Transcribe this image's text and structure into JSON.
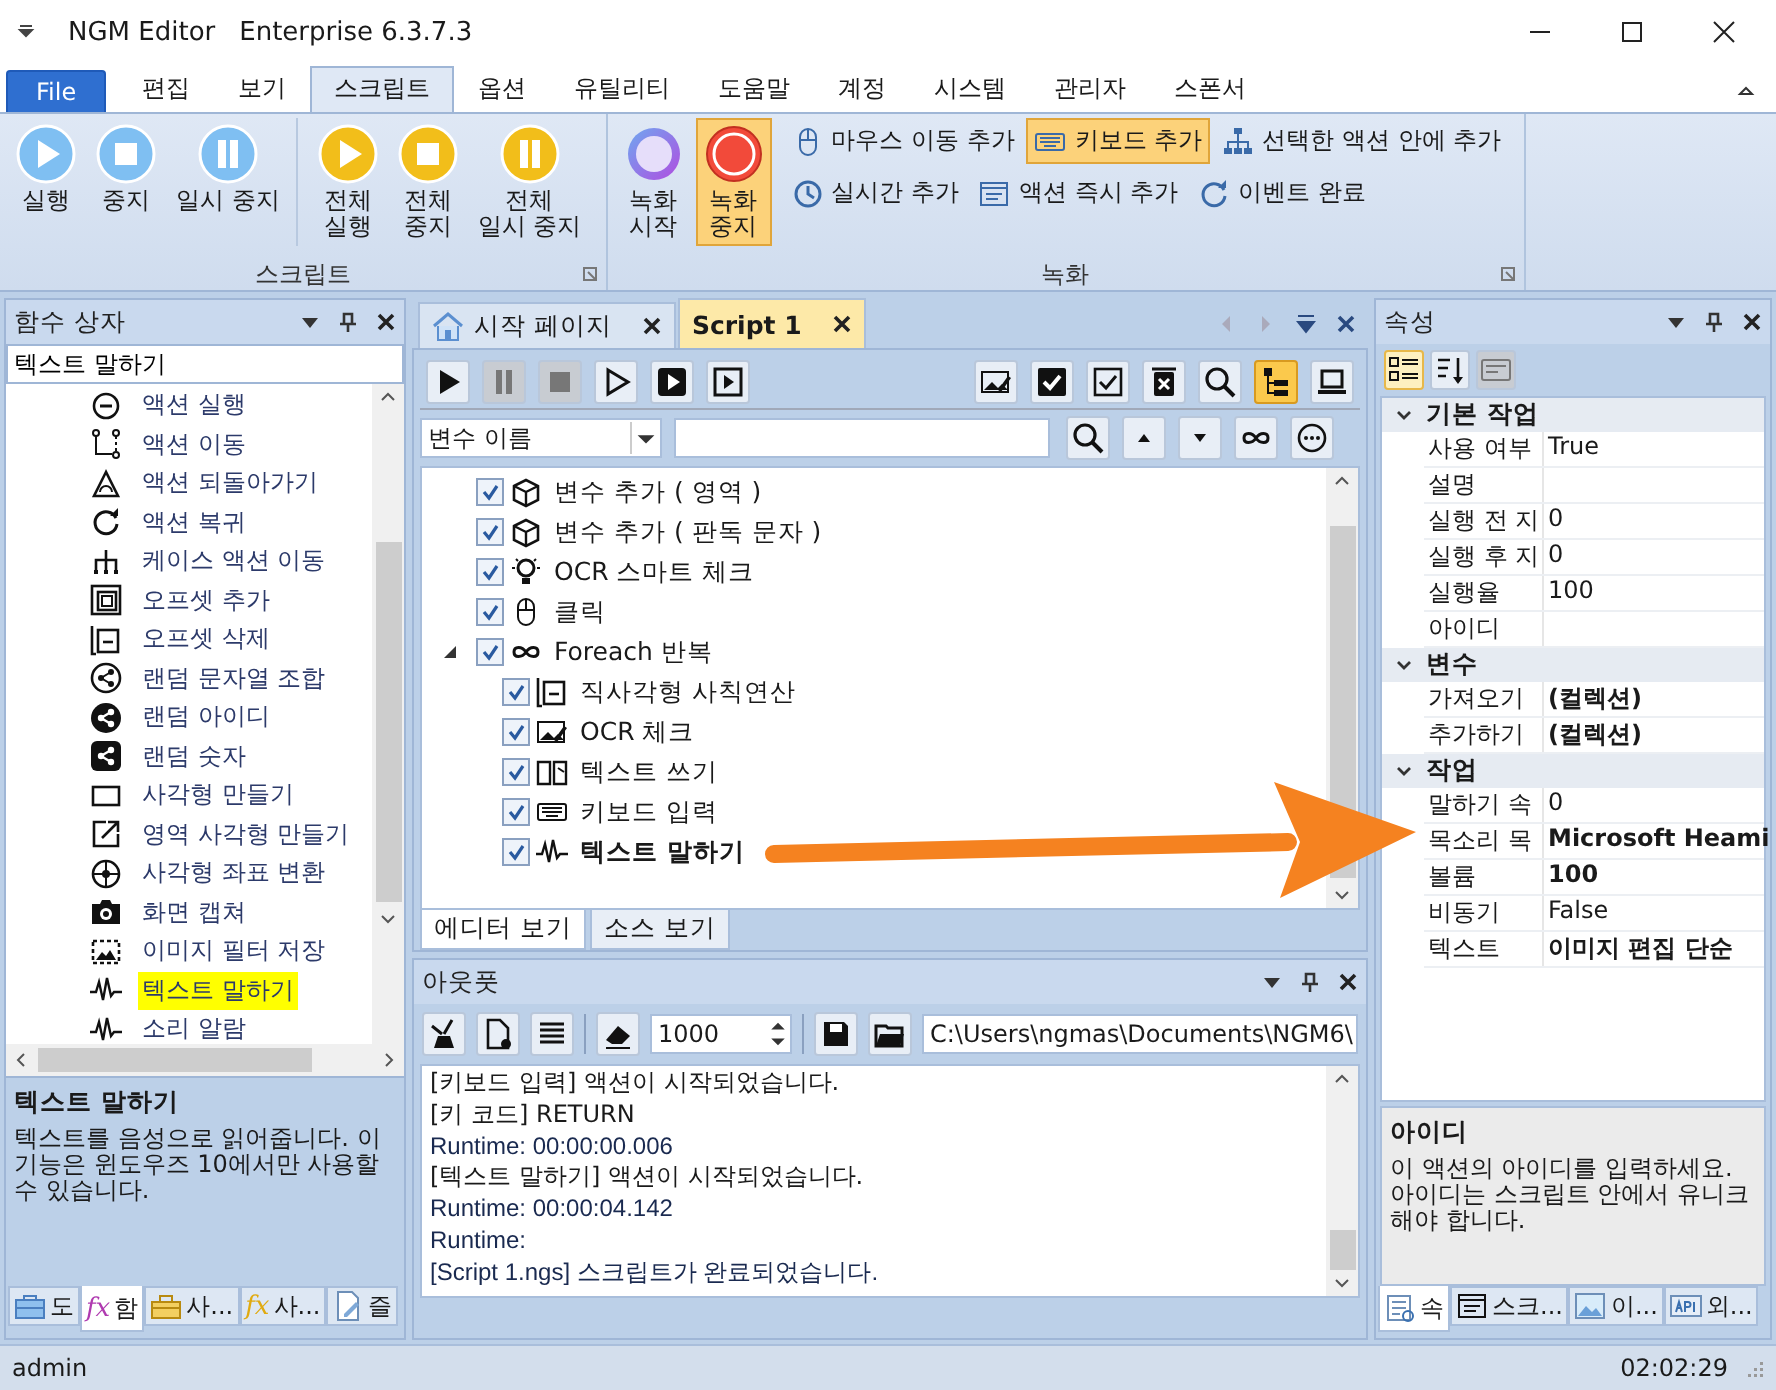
{
  "window": {
    "title": "NGM Editor",
    "edition": "Enterprise 6.3.7.3"
  },
  "menu_tabs": [
    {
      "label": "File",
      "kind": "file",
      "selected": false
    },
    {
      "label": "편집",
      "kind": "tab",
      "selected": false
    },
    {
      "label": "보기",
      "kind": "tab",
      "selected": false
    },
    {
      "label": "스크립트",
      "kind": "tab",
      "selected": true
    },
    {
      "label": "옵션",
      "kind": "tab",
      "selected": false
    },
    {
      "label": "유틸리티",
      "kind": "tab",
      "selected": false
    },
    {
      "label": "도움말",
      "kind": "tab",
      "selected": false
    },
    {
      "label": "계정",
      "kind": "tab",
      "selected": false
    },
    {
      "label": "시스템",
      "kind": "tab",
      "selected": false
    },
    {
      "label": "관리자",
      "kind": "tab",
      "selected": false
    },
    {
      "label": "스폰서",
      "kind": "tab",
      "selected": false
    }
  ],
  "ribbon": {
    "script": {
      "label": "스크립트",
      "sets": [
        {
          "buttons": [
            {
              "label": "실행",
              "kind": "play",
              "color": "#7fbff2"
            },
            {
              "label": "중지",
              "kind": "stop",
              "color": "#7fbff2"
            },
            {
              "label": "일시 중지",
              "kind": "pause",
              "color": "#7fbff2"
            }
          ]
        },
        {
          "buttons": [
            {
              "label": "전체\n실행",
              "kind": "play",
              "color": "#f2be1a"
            },
            {
              "label": "전체\n중지",
              "kind": "stop",
              "color": "#f2be1a"
            },
            {
              "label": "전체\n일시 중지",
              "kind": "pause",
              "color": "#f2be1a"
            }
          ]
        }
      ]
    },
    "record": {
      "label": "녹화",
      "buttons": [
        {
          "label": "녹화\n시작",
          "kind": "ring",
          "selected": false
        },
        {
          "label": "녹화\n중지",
          "kind": "dot",
          "selected": true
        }
      ],
      "rows": [
        {
          "actions": [
            {
              "label": "마우스 이동 추가",
              "kind": "mouse",
              "selected": false
            },
            {
              "label": "키보드 추가",
              "kind": "keyboard",
              "selected": true
            },
            {
              "label": "선택한 액션 안에 추가",
              "kind": "hierarchy",
              "selected": false
            }
          ]
        },
        {
          "actions": [
            {
              "label": "실시간 추가",
              "kind": "clock",
              "selected": false
            },
            {
              "label": "액션 즉시 추가",
              "kind": "window",
              "selected": false
            },
            {
              "label": "이벤트 완료",
              "kind": "refresh",
              "selected": false
            }
          ]
        }
      ]
    }
  },
  "function_box": {
    "title": "함수 상자",
    "search": "텍스트 말하기",
    "items": [
      {
        "label": "액션 실행",
        "kind": "circle-dash",
        "selected": false
      },
      {
        "label": "액션 이동",
        "kind": "dotted-path",
        "selected": false
      },
      {
        "label": "액션 되돌아가기",
        "kind": "triangle",
        "selected": false
      },
      {
        "label": "액션 복귀",
        "kind": "refresh",
        "selected": false
      },
      {
        "label": "케이스 액션 이동",
        "kind": "branch",
        "selected": false
      },
      {
        "label": "오프셋 추가",
        "kind": "nested-squares",
        "selected": false
      },
      {
        "label": "오프셋 삭제",
        "kind": "square-minus",
        "selected": false
      },
      {
        "label": "랜덤 문자열 조합",
        "kind": "share",
        "selected": false
      },
      {
        "label": "랜덤 아이디",
        "kind": "share-filled",
        "selected": false
      },
      {
        "label": "랜덤 숫자",
        "kind": "share-square",
        "selected": false
      },
      {
        "label": "사각형 만들기",
        "kind": "rectangle",
        "selected": false
      },
      {
        "label": "영역 사각형 만들기",
        "kind": "rectangle-arrow",
        "selected": false
      },
      {
        "label": "사각형 좌표 변환",
        "kind": "crosshair",
        "selected": false
      },
      {
        "label": "화면 캡쳐",
        "kind": "camera",
        "selected": false
      },
      {
        "label": "이미지 필터 저장",
        "kind": "image",
        "selected": false
      },
      {
        "label": "텍스트 말하기",
        "kind": "waveform",
        "selected": true
      },
      {
        "label": "소리 알람",
        "kind": "waveform",
        "selected": false
      }
    ],
    "description": {
      "title": "텍스트 말하기",
      "text": "텍스트를 음성으로 읽어줍니다. 이 기능은 윈도우즈 10에서만 사용할 수 있습니다."
    },
    "tabs": [
      {
        "label": "도",
        "kind": "toolbox",
        "selected": false
      },
      {
        "label": "함",
        "kind": "fx",
        "glyph": "fx",
        "color": "#b03ab0",
        "selected": true
      },
      {
        "label": "사...",
        "kind": "toolbox-open",
        "selected": false
      },
      {
        "label": "사...",
        "kind": "fx",
        "glyph": "fx",
        "color": "#e0aa10",
        "selected": false
      },
      {
        "label": "즐",
        "kind": "document",
        "selected": false
      }
    ]
  },
  "editor": {
    "tabs": [
      {
        "label": "시작 페이지",
        "kind": "home",
        "selected": false
      },
      {
        "label": "Script 1",
        "kind": "plain",
        "selected": true
      }
    ],
    "toolbar_left": [
      {
        "kind": "play",
        "disabled": false,
        "selected": false
      },
      {
        "kind": "pause",
        "disabled": true,
        "selected": false
      },
      {
        "kind": "stop",
        "disabled": true,
        "selected": false
      },
      {
        "kind": "play-outline",
        "disabled": false,
        "selected": false
      },
      {
        "kind": "play-box",
        "disabled": false,
        "selected": false
      },
      {
        "kind": "play-frame",
        "disabled": false,
        "selected": false
      }
    ],
    "toolbar_right": [
      {
        "kind": "image-edit",
        "disabled": false,
        "selected": false
      },
      {
        "kind": "check-filled",
        "disabled": false,
        "selected": false
      },
      {
        "kind": "check",
        "disabled": false,
        "selected": false
      },
      {
        "kind": "delete",
        "disabled": false,
        "selected": false
      },
      {
        "kind": "search",
        "disabled": false,
        "selected": false
      },
      {
        "kind": "tree",
        "disabled": false,
        "selected": true
      },
      {
        "kind": "laptop",
        "disabled": false,
        "selected": false
      }
    ],
    "filter": {
      "field": "변수 이름",
      "buttons": [
        {
          "kind": "search"
        },
        {
          "kind": "up"
        },
        {
          "kind": "down"
        },
        {
          "kind": "infinity"
        },
        {
          "kind": "more"
        }
      ]
    },
    "tree": [
      {
        "label": "변수 추가 ( 영역 )",
        "kind": "cube",
        "checked": true,
        "selected": false
      },
      {
        "label": "변수 추가 ( 판독 문자 )",
        "kind": "cube",
        "checked": true,
        "selected": false
      },
      {
        "label": "OCR 스마트 체크",
        "kind": "bulb",
        "checked": true,
        "selected": false
      },
      {
        "label": "클릭",
        "kind": "mouse",
        "checked": true,
        "selected": false
      },
      {
        "label": "Foreach 반복",
        "kind": "infinity",
        "checked": true,
        "selected": false,
        "expanded": true,
        "children": [
          {
            "label": "직사각형 사칙연산",
            "kind": "square-minus",
            "checked": true,
            "selected": false
          },
          {
            "label": "OCR 체크",
            "kind": "image-edit",
            "checked": true,
            "selected": false
          },
          {
            "label": "텍스트 쓰기",
            "kind": "book",
            "checked": true,
            "selected": false
          },
          {
            "label": "키보드 입력",
            "kind": "keyboard",
            "checked": true,
            "selected": false
          },
          {
            "label": "텍스트 말하기",
            "kind": "waveform",
            "checked": true,
            "selected": true
          }
        ]
      }
    ],
    "view_tabs": [
      {
        "label": "에디터 보기",
        "selected": true
      },
      {
        "label": "소스 보기",
        "selected": false
      }
    ]
  },
  "output": {
    "title": "아웃풋",
    "tools_left": [
      {
        "kind": "broom"
      },
      {
        "kind": "doc-check"
      },
      {
        "kind": "lines"
      }
    ],
    "tools_mid": [
      {
        "kind": "eraser"
      }
    ],
    "limit": "1000",
    "tools_right": [
      {
        "kind": "save"
      },
      {
        "kind": "folder"
      }
    ],
    "path": "C:\\Users\\ngmas\\Documents\\NGM6\\",
    "log": [
      {
        "text": "[키보드 입력] 액션이 시작되었습니다.",
        "kind": "message"
      },
      {
        "text": "[키 코드] RETURN",
        "kind": "message"
      },
      {
        "text": "Runtime: 00:00:00.006",
        "kind": "runtime"
      },
      {
        "text": "[텍스트 말하기] 액션이 시작되었습니다.",
        "kind": "message"
      },
      {
        "text": "Runtime: 00:00:04.142",
        "kind": "runtime"
      },
      {
        "text": "Runtime:",
        "kind": "runtime"
      },
      {
        "text": "[Script 1.ngs] 스크립트가 완료되었습니다.",
        "kind": "runtime"
      }
    ]
  },
  "properties": {
    "title": "속성",
    "toolbar": [
      {
        "kind": "categorized",
        "selected": true,
        "disabled": false
      },
      {
        "kind": "sort",
        "selected": false,
        "disabled": false
      },
      {
        "kind": "pages",
        "selected": false,
        "disabled": true
      }
    ],
    "categories": [
      {
        "name": "기본 작업",
        "expanded": true,
        "rows": [
          {
            "name": "사용 여부",
            "value": "True",
            "modified": false
          },
          {
            "name": "설명",
            "modified": false
          },
          {
            "name": "실행 전 지",
            "value": "0",
            "modified": false
          },
          {
            "name": "실행 후 지",
            "value": "0",
            "modified": false
          },
          {
            "name": "실행율",
            "value": "100",
            "modified": false
          },
          {
            "name": "아이디",
            "modified": false
          }
        ]
      },
      {
        "name": "변수",
        "expanded": true,
        "rows": [
          {
            "name": "가져오기",
            "value": "(컬렉션)",
            "modified": true
          },
          {
            "name": "추가하기",
            "value": "(컬렉션)",
            "modified": true
          }
        ]
      },
      {
        "name": "작업",
        "expanded": true,
        "rows": [
          {
            "name": "말하기 속",
            "value": "0",
            "modified": false
          },
          {
            "name": "목소리 목",
            "value": "Microsoft Heami",
            "modified": true
          },
          {
            "name": "볼륨",
            "value": "100",
            "modified": true
          },
          {
            "name": "비동기",
            "value": "False",
            "modified": false
          },
          {
            "name": "텍스트",
            "value": "이미지 편집 단순",
            "modified": true
          }
        ]
      }
    ],
    "description": {
      "title": "아이디",
      "text": "이 액션의 아이디를 입력하세요. 아이디는 스크립트 안에서 유니크 해야 합니다."
    },
    "tabs": [
      {
        "label": "속",
        "kind": "props",
        "selected": true
      },
      {
        "label": "스크...",
        "kind": "window",
        "selected": false
      },
      {
        "label": "이...",
        "kind": "picture",
        "selected": false
      },
      {
        "label": "외...",
        "kind": "api",
        "selected": false
      }
    ]
  },
  "status": {
    "user": "admin",
    "time": "02:02:29"
  }
}
